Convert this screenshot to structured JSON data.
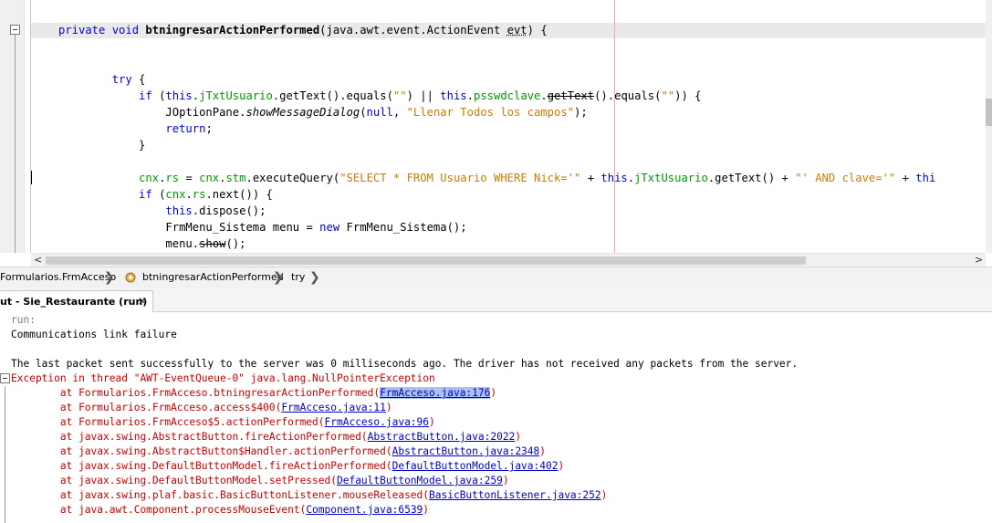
{
  "editor": {
    "code_lines": [
      {
        "parts": [
          {
            "t": "private void ",
            "c": "kw"
          },
          {
            "t": "btningresarActionPerformed",
            "c": "bold"
          },
          {
            "t": "(java.awt.event.ActionEvent ",
            "c": ""
          },
          {
            "t": "evt",
            "c": "under"
          },
          {
            "t": ") {",
            "c": ""
          }
        ]
      },
      {
        "parts": []
      },
      {
        "parts": []
      },
      {
        "parts": [
          {
            "t": "        try",
            "c": "kw"
          },
          {
            "t": " {",
            "c": ""
          }
        ]
      },
      {
        "parts": [
          {
            "t": "            if",
            "c": "kw"
          },
          {
            "t": " (",
            "c": ""
          },
          {
            "t": "this",
            "c": "kw"
          },
          {
            "t": ".",
            "c": ""
          },
          {
            "t": "jTxtUsuario",
            "c": "fld"
          },
          {
            "t": ".getText().equals(",
            "c": ""
          },
          {
            "t": "\"\"",
            "c": "str"
          },
          {
            "t": ") || ",
            "c": ""
          },
          {
            "t": "this",
            "c": "kw"
          },
          {
            "t": ".",
            "c": ""
          },
          {
            "t": "psswdclave",
            "c": "fld"
          },
          {
            "t": ".",
            "c": ""
          },
          {
            "t": "getText",
            "c": "strike"
          },
          {
            "t": "().equals(",
            "c": ""
          },
          {
            "t": "\"\"",
            "c": "str"
          },
          {
            "t": ")) {",
            "c": ""
          }
        ]
      },
      {
        "parts": [
          {
            "t": "                JOptionPane.",
            "c": ""
          },
          {
            "t": "showMessageDialog",
            "c": "it"
          },
          {
            "t": "(",
            "c": ""
          },
          {
            "t": "null",
            "c": "kw"
          },
          {
            "t": ", ",
            "c": ""
          },
          {
            "t": "\"Llenar Todos los campos\"",
            "c": "str"
          },
          {
            "t": ");",
            "c": ""
          }
        ]
      },
      {
        "parts": [
          {
            "t": "                return",
            "c": "kw"
          },
          {
            "t": ";",
            "c": ""
          }
        ]
      },
      {
        "parts": [
          {
            "t": "            }",
            "c": ""
          }
        ]
      },
      {
        "parts": []
      },
      {
        "parts": [
          {
            "t": "            cnx",
            "c": "fld"
          },
          {
            "t": ".",
            "c": ""
          },
          {
            "t": "rs",
            "c": "fld"
          },
          {
            "t": " = ",
            "c": ""
          },
          {
            "t": "cnx",
            "c": "fld"
          },
          {
            "t": ".",
            "c": ""
          },
          {
            "t": "stm",
            "c": "fld"
          },
          {
            "t": ".executeQuery(",
            "c": ""
          },
          {
            "t": "\"SELECT * FROM Usuario WHERE Nick='\"",
            "c": "str"
          },
          {
            "t": " + ",
            "c": ""
          },
          {
            "t": "this",
            "c": "kw"
          },
          {
            "t": ".",
            "c": ""
          },
          {
            "t": "jTxtUsuario",
            "c": "fld"
          },
          {
            "t": ".getText() + ",
            "c": ""
          },
          {
            "t": "\"' AND clave='\"",
            "c": "str"
          },
          {
            "t": " + ",
            "c": ""
          },
          {
            "t": "thi",
            "c": "kw"
          }
        ]
      },
      {
        "parts": [
          {
            "t": "            if",
            "c": "kw"
          },
          {
            "t": " (",
            "c": ""
          },
          {
            "t": "cnx",
            "c": "fld"
          },
          {
            "t": ".",
            "c": ""
          },
          {
            "t": "rs",
            "c": "fld"
          },
          {
            "t": ".next()) {",
            "c": ""
          }
        ]
      },
      {
        "parts": [
          {
            "t": "                this",
            "c": "kw"
          },
          {
            "t": ".dispose();",
            "c": ""
          }
        ]
      },
      {
        "parts": [
          {
            "t": "                FrmMenu_Sistema menu = ",
            "c": ""
          },
          {
            "t": "new",
            "c": "kw"
          },
          {
            "t": " FrmMenu_Sistema();",
            "c": ""
          }
        ]
      },
      {
        "parts": [
          {
            "t": "                menu.",
            "c": ""
          },
          {
            "t": "show",
            "c": "strike"
          },
          {
            "t": "();",
            "c": ""
          }
        ]
      }
    ],
    "scroll_left": "<",
    "scroll_right": ">"
  },
  "breadcrumb": {
    "items": [
      "Formularios.FrmAcceso",
      "btningresarActionPerformed",
      "try"
    ],
    "separator": "❯"
  },
  "output_tab": {
    "label": "ut - Sie_Restaurante (run)",
    "close": "✕"
  },
  "output": {
    "lines": [
      {
        "text": "run:",
        "cls": "grey",
        "link": ""
      },
      {
        "text": "Communications link failure",
        "cls": "",
        "link": ""
      },
      {
        "text": "",
        "cls": "",
        "link": ""
      },
      {
        "text": "The last packet sent successfully to the server was 0 milliseconds ago. The driver has not received any packets from the server.",
        "cls": "",
        "link": ""
      },
      {
        "text": "Exception in thread \"AWT-EventQueue-0\" java.lang.NullPointerException",
        "cls": "red",
        "link": ""
      },
      {
        "text": "        at Formularios.FrmAcceso.btningresarActionPerformed(",
        "cls": "red",
        "link": "FrmAcceso.java:176",
        "sel": true
      },
      {
        "text": "        at Formularios.FrmAcceso.access$400(",
        "cls": "red",
        "link": "FrmAcceso.java:11"
      },
      {
        "text": "        at Formularios.FrmAcceso$5.actionPerformed(",
        "cls": "red",
        "link": "FrmAcceso.java:96"
      },
      {
        "text": "        at javax.swing.AbstractButton.fireActionPerformed(",
        "cls": "red",
        "link": "AbstractButton.java:2022"
      },
      {
        "text": "        at javax.swing.AbstractButton$Handler.actionPerformed(",
        "cls": "red",
        "link": "AbstractButton.java:2348"
      },
      {
        "text": "        at javax.swing.DefaultButtonModel.fireActionPerformed(",
        "cls": "red",
        "link": "DefaultButtonModel.java:402"
      },
      {
        "text": "        at javax.swing.DefaultButtonModel.setPressed(",
        "cls": "red",
        "link": "DefaultButtonModel.java:259"
      },
      {
        "text": "        at javax.swing.plaf.basic.BasicButtonListener.mouseReleased(",
        "cls": "red",
        "link": "BasicButtonListener.java:252"
      },
      {
        "text": "        at java.awt.Component.processMouseEvent(",
        "cls": "red",
        "link": "Component.java:6539"
      }
    ]
  },
  "colors": {
    "keyword": "#0000e6",
    "field": "#009900",
    "string": "#ce7b00",
    "error": "#cc0000",
    "link": "#0000cc",
    "link_selected_bg": "#a9c2f2"
  }
}
